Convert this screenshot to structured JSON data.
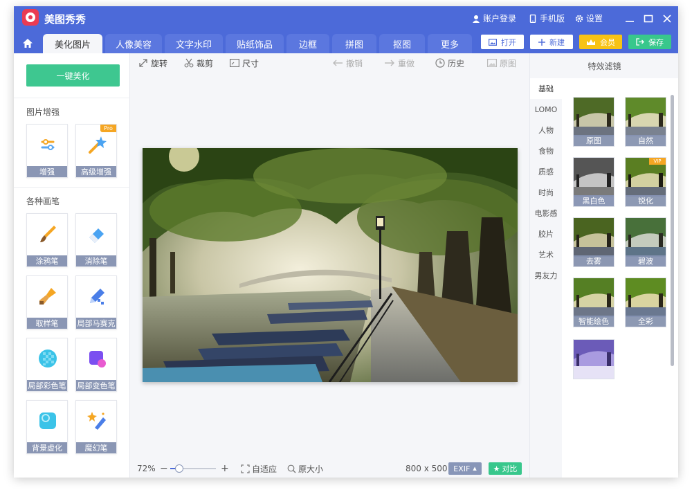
{
  "app": {
    "title": "美图秀秀"
  },
  "titlebar": {
    "login": "账户登录",
    "mobile": "手机版",
    "settings": "设置"
  },
  "tabs": [
    "美化图片",
    "人像美容",
    "文字水印",
    "贴纸饰品",
    "边框",
    "拼图",
    "抠图",
    "更多"
  ],
  "actions": {
    "open": "打开",
    "new": "新建",
    "vip": "会员",
    "save": "保存"
  },
  "left": {
    "one_key": "一键美化",
    "section_enhance": "图片增强",
    "section_brush": "各种画笔",
    "pro_badge": "Pro",
    "tools": [
      "增强",
      "高级增强",
      "涂鸦笔",
      "消除笔",
      "取样笔",
      "局部马赛克",
      "局部彩色笔",
      "局部变色笔",
      "背景虚化",
      "魔幻笔"
    ]
  },
  "toolbar": {
    "rotate": "旋转",
    "crop": "裁剪",
    "size": "尺寸",
    "undo": "撤销",
    "redo": "重做",
    "history": "历史",
    "original": "原图"
  },
  "bottom": {
    "zoom": "72%",
    "zoom_level": 0.2,
    "fit": "自适应",
    "actual_size": "原大小",
    "dimensions": "800 x 500",
    "exif": "EXIF",
    "compare": "对比"
  },
  "right": {
    "header": "特效滤镜",
    "categories": [
      "基础",
      "LOMO",
      "人物",
      "食物",
      "质感",
      "时尚",
      "电影感",
      "胶片",
      "艺术",
      "男友力"
    ],
    "vip_badge": "VIP",
    "filters": [
      "原图",
      "自然",
      "黑白色",
      "锐化",
      "去雾",
      "碧波",
      "智能绘色",
      "全彩"
    ]
  },
  "colors": {
    "primary": "#4c6ad9",
    "green": "#38c78c",
    "gold": "#f8c315",
    "red": "#ea3b52"
  }
}
